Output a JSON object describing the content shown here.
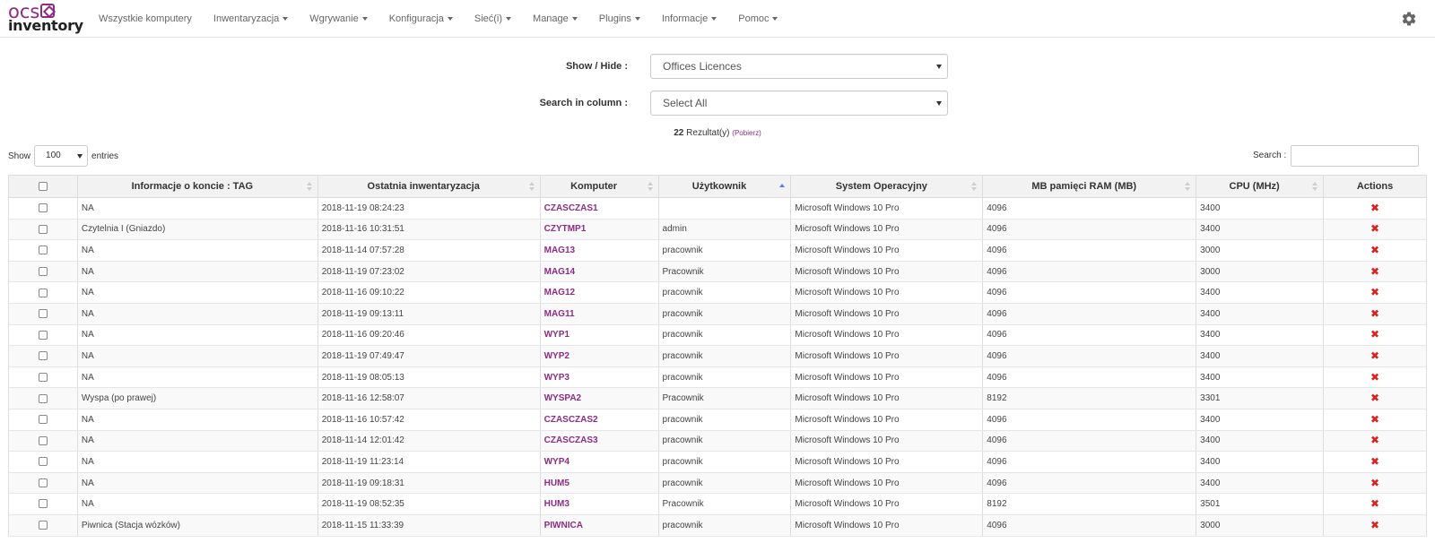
{
  "brand": {
    "top": "ocs",
    "bottom": "inventory"
  },
  "nav": [
    {
      "label": "Wszystkie komputery",
      "caret": false
    },
    {
      "label": "Inwentaryzacja",
      "caret": true
    },
    {
      "label": "Wgrywanie",
      "caret": true
    },
    {
      "label": "Konfiguracja",
      "caret": true
    },
    {
      "label": "Sieć(i)",
      "caret": true
    },
    {
      "label": "Manage",
      "caret": true
    },
    {
      "label": "Plugins",
      "caret": true
    },
    {
      "label": "Informacje",
      "caret": true
    },
    {
      "label": "Pomoc",
      "caret": true
    }
  ],
  "filters": {
    "show_hide_label": "Show / Hide :",
    "show_hide_value": "Offices Licences",
    "search_column_label": "Search in column :",
    "search_column_value": "Select All"
  },
  "results": {
    "count": "22",
    "text": "Rezultat(y)",
    "download": "(Pobierz)"
  },
  "table_controls": {
    "show_label": "Show",
    "entries_value": "100",
    "entries_label": "entries",
    "search_label": "Search :"
  },
  "table": {
    "columns": [
      {
        "label": "Informacje o koncie : TAG",
        "sort": "none"
      },
      {
        "label": "Ostatnia inwentaryzacja",
        "sort": "none"
      },
      {
        "label": "Komputer",
        "sort": "none"
      },
      {
        "label": "Użytkownik",
        "sort": "asc"
      },
      {
        "label": "System Operacyjny",
        "sort": "none"
      },
      {
        "label": "MB pamięci RAM (MB)",
        "sort": "none"
      },
      {
        "label": "CPU (MHz)",
        "sort": "none"
      },
      {
        "label": "Actions",
        "sort": "nosort"
      }
    ],
    "rows": [
      [
        "NA",
        "2018-11-19 08:24:23",
        "CZASCZAS1",
        "",
        "Microsoft Windows 10 Pro",
        "4096",
        "3400"
      ],
      [
        "Czytelnia I (Gniazdo)",
        "2018-11-16 10:31:51",
        "CZYTMP1",
        "admin",
        "Microsoft Windows 10 Pro",
        "4096",
        "3400"
      ],
      [
        "NA",
        "2018-11-14 07:57:28",
        "MAG13",
        "pracownik",
        "Microsoft Windows 10 Pro",
        "4096",
        "3000"
      ],
      [
        "NA",
        "2018-11-19 07:23:02",
        "MAG14",
        "Pracownik",
        "Microsoft Windows 10 Pro",
        "4096",
        "3000"
      ],
      [
        "NA",
        "2018-11-16 09:10:22",
        "MAG12",
        "pracownik",
        "Microsoft Windows 10 Pro",
        "4096",
        "3400"
      ],
      [
        "NA",
        "2018-11-19 09:13:11",
        "MAG11",
        "pracownik",
        "Microsoft Windows 10 Pro",
        "4096",
        "3400"
      ],
      [
        "NA",
        "2018-11-16 09:20:46",
        "WYP1",
        "pracownik",
        "Microsoft Windows 10 Pro",
        "4096",
        "3400"
      ],
      [
        "NA",
        "2018-11-19 07:49:47",
        "WYP2",
        "pracownik",
        "Microsoft Windows 10 Pro",
        "4096",
        "3400"
      ],
      [
        "NA",
        "2018-11-19 08:05:13",
        "WYP3",
        "pracownik",
        "Microsoft Windows 10 Pro",
        "4096",
        "3400"
      ],
      [
        "Wyspa (po prawej)",
        "2018-11-16 12:58:07",
        "WYSPA2",
        "Pracownik",
        "Microsoft Windows 10 Pro",
        "8192",
        "3301"
      ],
      [
        "NA",
        "2018-11-16 10:57:42",
        "CZASCZAS2",
        "pracownik",
        "Microsoft Windows 10 Pro",
        "4096",
        "3400"
      ],
      [
        "NA",
        "2018-11-14 12:01:42",
        "CZASCZAS3",
        "pracownik",
        "Microsoft Windows 10 Pro",
        "4096",
        "3400"
      ],
      [
        "NA",
        "2018-11-19 11:23:14",
        "WYP4",
        "pracownik",
        "Microsoft Windows 10 Pro",
        "4096",
        "3400"
      ],
      [
        "NA",
        "2018-11-19 09:18:31",
        "HUM5",
        "pracownik",
        "Microsoft Windows 10 Pro",
        "4096",
        "3400"
      ],
      [
        "NA",
        "2018-11-19 08:52:35",
        "HUM3",
        "Pracownik",
        "Microsoft Windows 10 Pro",
        "8192",
        "3501"
      ],
      [
        "Piwnica (Stacja wózków)",
        "2018-11-15 11:33:39",
        "PIWNICA",
        "pracownik",
        "Microsoft Windows 10 Pro",
        "4096",
        "3000"
      ]
    ]
  },
  "colors": {
    "accent": "#8e2c85",
    "delete": "#d9231d",
    "sort_active": "#5b7bd6"
  }
}
